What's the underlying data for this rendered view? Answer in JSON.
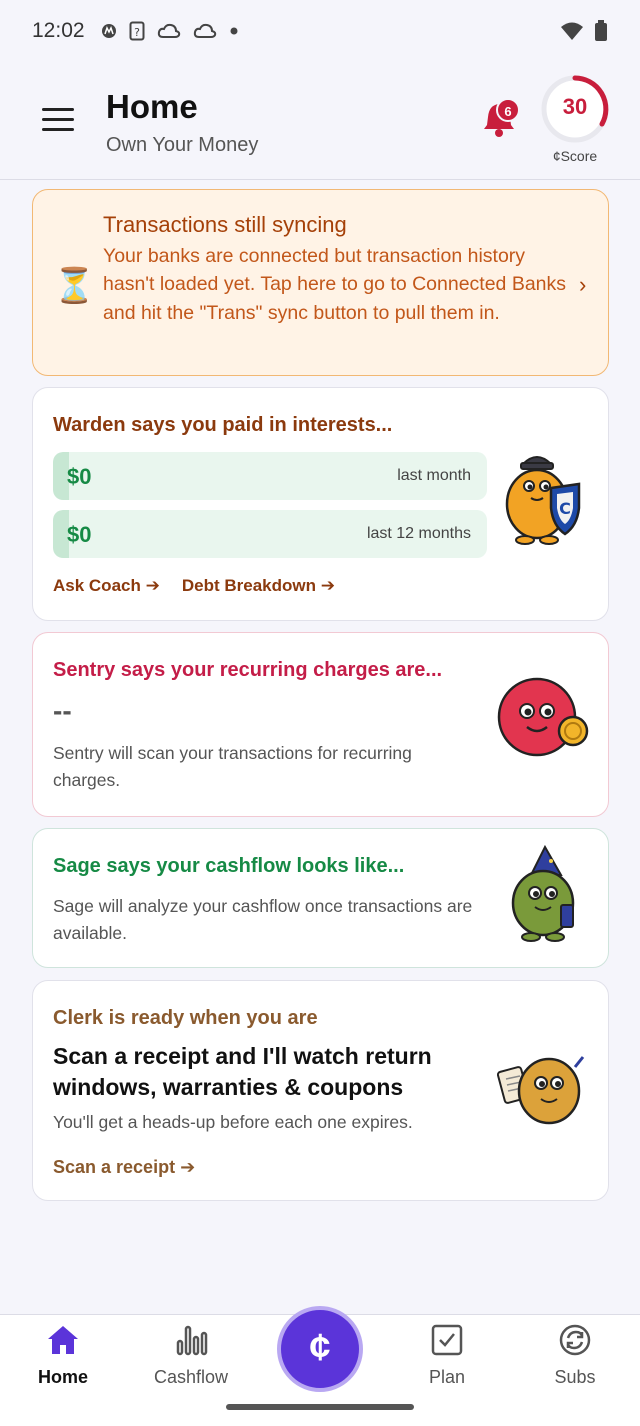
{
  "status_bar": {
    "time": "12:02",
    "icons": [
      "motorola-icon",
      "sim-question-icon",
      "cloud-icon",
      "cloud-icon",
      "dot-icon",
      "wifi-icon",
      "battery-icon"
    ]
  },
  "header": {
    "title": "Home",
    "subtitle": "Own Your Money",
    "notification_count": "6",
    "score_value": "30",
    "score_label": "¢Score",
    "accent": "#c81e3c"
  },
  "sync_banner": {
    "title": "Transactions still syncing",
    "body": "Your banks are connected but transaction history hasn't loaded yet. Tap here to go to Connected Banks and hit the \"Trans\" sync button to pull them in.",
    "chevron": "›"
  },
  "warden": {
    "heading": "Warden says you paid in interests...",
    "rows": [
      {
        "amount": "$0",
        "period": "last month"
      },
      {
        "amount": "$0",
        "period": "last 12 months"
      }
    ],
    "link_coach": "Ask Coach ➔",
    "link_debt": "Debt Breakdown ➔"
  },
  "sentry": {
    "heading": "Sentry says your recurring charges are...",
    "value": "--",
    "body": "Sentry will scan your transactions for recurring charges."
  },
  "sage": {
    "heading": "Sage says your cashflow looks like...",
    "body": "Sage will analyze your cashflow once transactions are available."
  },
  "clerk": {
    "heading": "Clerk is ready when you are",
    "headline": "Scan a receipt and I'll watch return windows, warranties & coupons",
    "body": "You'll get a heads-up before each one expires.",
    "link": "Scan a receipt ➔"
  },
  "nav": {
    "home": "Home",
    "cashflow": "Cashflow",
    "center": "¢",
    "plan": "Plan",
    "subs": "Subs",
    "active_color": "#5b34d9"
  }
}
